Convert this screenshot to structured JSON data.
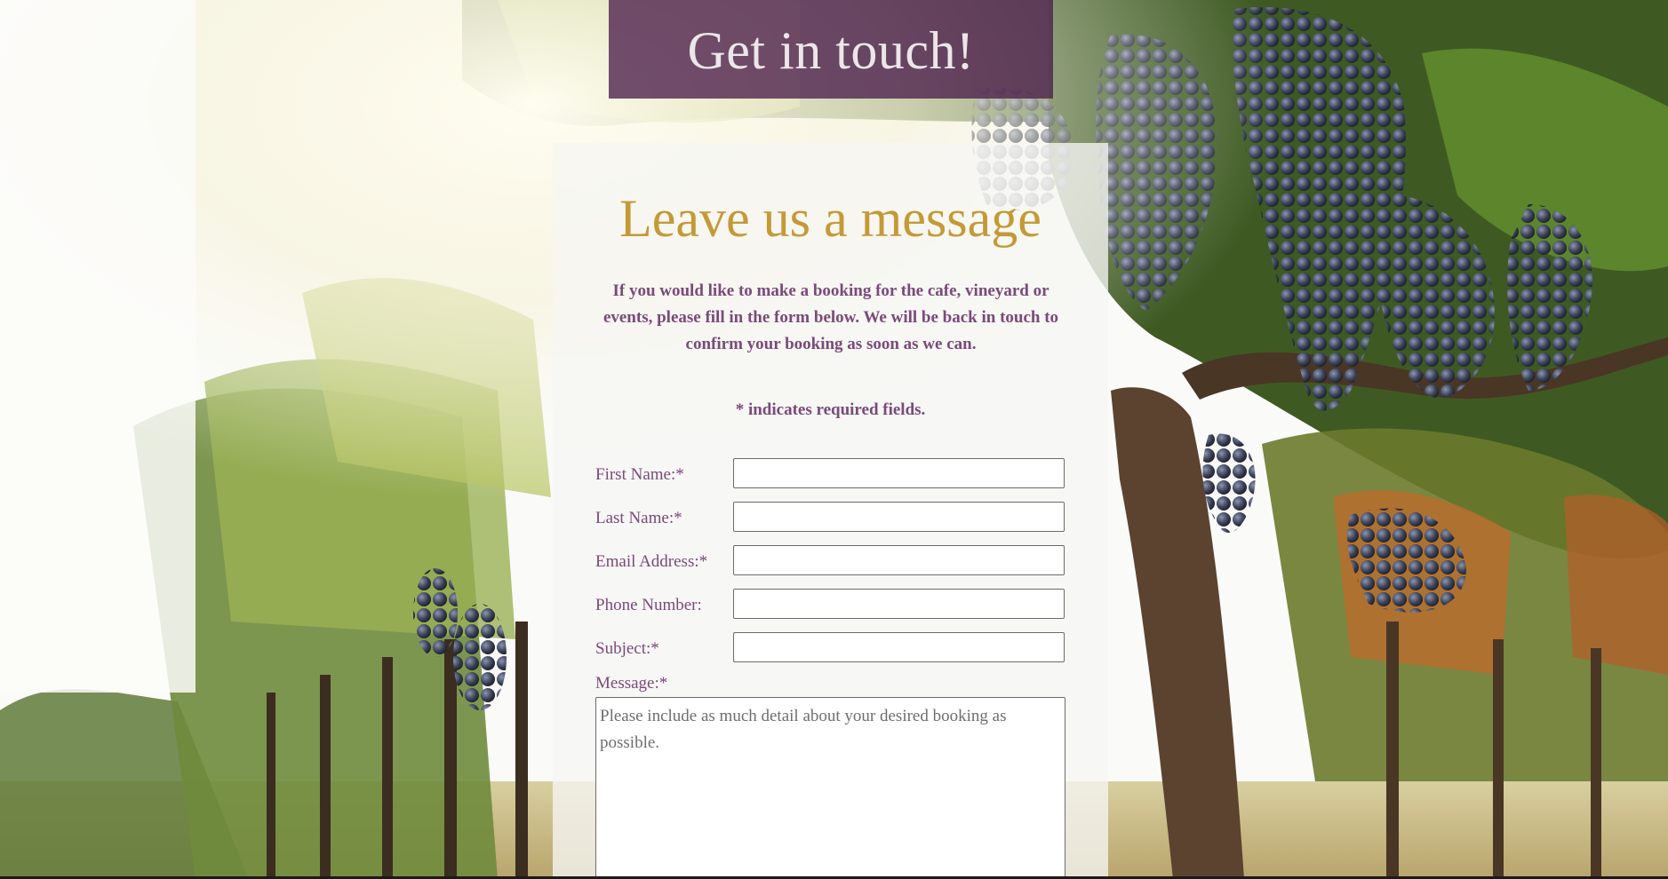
{
  "header": {
    "title": "Get in touch!"
  },
  "form": {
    "title": "Leave us a message",
    "intro": "If you would like to make a booking for the cafe, vineyard or events, please fill in the form below. We will be back in touch to confirm your booking as soon as we can.",
    "required_note": "* indicates required fields.",
    "fields": {
      "first_name": {
        "label": "First Name:*",
        "value": ""
      },
      "last_name": {
        "label": "Last Name:*",
        "value": ""
      },
      "email": {
        "label": "Email Address:*",
        "value": ""
      },
      "phone": {
        "label": "Phone Number:",
        "value": ""
      },
      "subject": {
        "label": "Subject:*",
        "value": ""
      },
      "message": {
        "label": "Message:*",
        "placeholder": "Please include as much detail about your desired booking as possible."
      }
    }
  },
  "colors": {
    "banner": "#4b1e4b",
    "title_gold": "#c49a36",
    "text_purple": "#7a4a7a"
  }
}
